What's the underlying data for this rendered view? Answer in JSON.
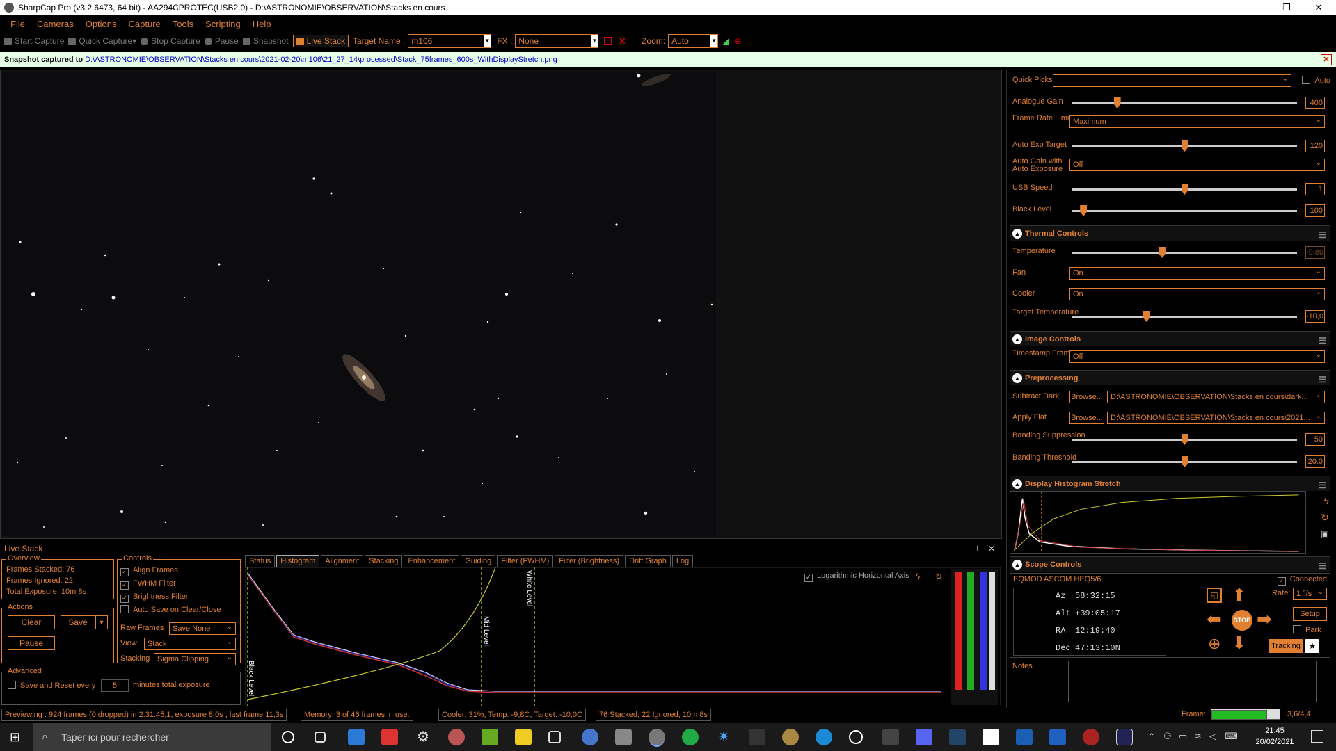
{
  "window": {
    "title": "SharpCap Pro (v3.2.6473, 64 bit) - AA294CPROTEC(USB2.0) - D:\\ASTRONOMIE\\OBSERVATION\\Stacks en cours",
    "minimize": "–",
    "maximize": "❐",
    "close": "✕"
  },
  "menu": [
    "File",
    "Cameras",
    "Options",
    "Capture",
    "Tools",
    "Scripting",
    "Help"
  ],
  "toolbar": {
    "start_capture": "Start Capture",
    "quick_capture": "Quick Capture",
    "stop_capture": "Stop Capture",
    "pause": "Pause",
    "snapshot": "Snapshot",
    "live_stack": "Live Stack",
    "target_name_label": "Target Name :",
    "target_name_value": "m106",
    "fx_label": "FX :",
    "fx_value": "None",
    "zoom_label": "Zoom:",
    "zoom_value": "Auto"
  },
  "notification": {
    "prefix": "Snapshot captured to",
    "path": "D:\\ASTRONOMIE\\OBSERVATION\\Stacks en cours\\2021-02-20\\m106\\21_27_14\\processed\\Stack_75frames_600s_WithDisplayStretch.png"
  },
  "camera_controls": {
    "quick_picks_label": "Quick Picks",
    "auto_label": "Auto",
    "analogue_gain": {
      "label": "Analogue Gain",
      "value": "400",
      "fraction": 0.2
    },
    "frame_rate_limit": {
      "label": "Frame Rate Limit",
      "value": "Maximum"
    },
    "auto_exp_target": {
      "label": "Auto Exp Target",
      "value": "120",
      "fraction": 0.5
    },
    "auto_gain_with_auto_exposure": {
      "label": "Auto Gain with Auto Exposure",
      "value": "Off"
    },
    "usb_speed": {
      "label": "USB Speed",
      "value": "1",
      "fraction": 0.5
    },
    "black_level": {
      "label": "Black Level",
      "value": "100",
      "fraction": 0.05
    }
  },
  "thermal": {
    "title": "Thermal Controls",
    "temperature": {
      "label": "Temperature",
      "value": "-9,80",
      "fraction": 0.4
    },
    "fan": {
      "label": "Fan",
      "value": "On"
    },
    "cooler": {
      "label": "Cooler",
      "value": "On"
    },
    "target_temperature": {
      "label": "Target Temperature",
      "value": "-10,0",
      "fraction": 0.33
    }
  },
  "image_controls": {
    "title": "Image Controls",
    "timestamp_frames": {
      "label": "Timestamp Frames",
      "value": "Off"
    }
  },
  "preprocessing": {
    "title": "Preprocessing",
    "subtract_dark": {
      "label": "Subtract Dark",
      "browse": "Browse...",
      "value": "D:\\ASTRONOMIE\\OBSERVATION\\Stacks en cours\\dark..."
    },
    "apply_flat": {
      "label": "Apply Flat",
      "browse": "Browse...",
      "value": "D:\\ASTRONOMIE\\OBSERVATION\\Stacks en cours\\2021..."
    },
    "banding_suppression": {
      "label": "Banding Suppression",
      "value": "50",
      "fraction": 0.5
    },
    "banding_threshold": {
      "label": "Banding Threshold",
      "value": "20.0",
      "fraction": 0.5
    }
  },
  "display_histogram": {
    "title": "Display Histogram Stretch"
  },
  "scope": {
    "title": "Scope Controls",
    "mount": "EQMOD ASCOM HEQ5/6",
    "connected": "Connected",
    "az_label": "Az",
    "az_value": "58:32:15",
    "alt_label": "Alt",
    "alt_value": "+39:05:17",
    "ra_label": "RA",
    "ra_value": "12:19:40",
    "dec_label": "Dec",
    "dec_value": "47:13:10N",
    "rate_label": "Rate:",
    "rate_value": "1 °/s",
    "setup": "Setup",
    "park": "Park",
    "stop": "STOP",
    "tracking": "Tracking",
    "notes_label": "Notes"
  },
  "live_stack": {
    "title": "Live Stack",
    "overview_title": "Overview",
    "frames_stacked_label": "Frames Stacked:",
    "frames_stacked": "76",
    "frames_ignored_label": "Frames Ignored:",
    "frames_ignored": "22",
    "total_exposure_label": "Total Exposure:",
    "total_exposure": "10m 8s",
    "actions_title": "Actions",
    "clear": "Clear",
    "save": "Save",
    "pause": "Pause",
    "advanced_title": "Advanced",
    "save_reset_label": "Save and Reset every",
    "save_reset_value": "5",
    "save_reset_suffix": "minutes total exposure",
    "controls_title": "Controls",
    "align_frames": "Align Frames",
    "fwhm_filter": "FWHM Filter",
    "brightness_filter": "Brightness Filter",
    "auto_save": "Auto Save on Clear/Close",
    "raw_frames_label": "Raw Frames",
    "raw_frames_value": "Save None",
    "view_label": "View",
    "view_value": "Stack",
    "stacking_label": "Stacking",
    "stacking_value": "Sigma Clipping",
    "tabs": [
      "Status",
      "Histogram",
      "Alignment",
      "Stacking",
      "Enhancement",
      "Guiding",
      "Filter (FWHM)",
      "Filter (Brightness)",
      "Drift Graph",
      "Log"
    ],
    "log_axis": "Logarithmic Horizontal Axis",
    "black_level": "Black Level",
    "mid_level": "Mid Level",
    "white_level": "White Level"
  },
  "status": {
    "previewing": "Previewing : 924 frames (0 dropped) in 2:31:45,1, exposure 8,0s , last frame 11,3s",
    "memory": "Memory: 3 of 46 frames in use.",
    "cooler": "Cooler: 31%, Temp: -9,8C, Target: -10,0C",
    "stacked": "76 Stacked, 22 Ignored, 10m 8s",
    "frame_label": "Frame:",
    "frame_value": "3,6/4,4"
  },
  "taskbar": {
    "search_placeholder": "Taper ici pour rechercher",
    "time": "21:45",
    "date": "20/02/2021"
  },
  "colors": {
    "accent": "#e08030",
    "notif_bg": "#e6ffe6",
    "link": "#0000cc"
  }
}
